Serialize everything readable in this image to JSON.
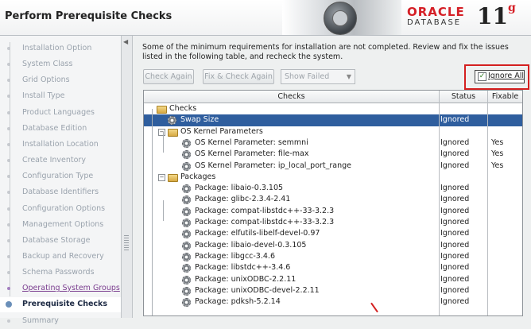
{
  "window": {
    "title": "Perform Prerequisite Checks"
  },
  "brand": {
    "oracle": "ORACLE",
    "database": "DATABASE",
    "version": "11",
    "version_sup": "g"
  },
  "sidebar": {
    "items": [
      {
        "label": "Installation Option",
        "state": "done"
      },
      {
        "label": "System Class",
        "state": "done"
      },
      {
        "label": "Grid Options",
        "state": "done"
      },
      {
        "label": "Install Type",
        "state": "done"
      },
      {
        "label": "Product Languages",
        "state": "done"
      },
      {
        "label": "Database Edition",
        "state": "done"
      },
      {
        "label": "Installation Location",
        "state": "done"
      },
      {
        "label": "Create Inventory",
        "state": "done"
      },
      {
        "label": "Configuration Type",
        "state": "done"
      },
      {
        "label": "Database Identifiers",
        "state": "done"
      },
      {
        "label": "Configuration Options",
        "state": "done"
      },
      {
        "label": "Management Options",
        "state": "done"
      },
      {
        "label": "Database Storage",
        "state": "done"
      },
      {
        "label": "Backup and Recovery",
        "state": "done"
      },
      {
        "label": "Schema Passwords",
        "state": "done"
      },
      {
        "label": "Operating System Groups",
        "state": "link"
      },
      {
        "label": "Prerequisite Checks",
        "state": "current"
      },
      {
        "label": "Summary",
        "state": "next"
      }
    ]
  },
  "main": {
    "message": "Some of the minimum requirements for installation are not completed. Review and fix the issues listed in the following table, and recheck the system.",
    "toolbar": {
      "check_again": "Check Again",
      "fix_check_again": "Fix & Check Again",
      "filter_value": "Show Failed",
      "ignore_all": "Ignore All",
      "ignore_all_checked": true
    },
    "table": {
      "headers": {
        "checks": "Checks",
        "status": "Status",
        "fixable": "Fixable"
      },
      "rows": [
        {
          "name": "Checks",
          "status": "",
          "fixable": "",
          "level": 0,
          "icon": "folder-icon",
          "toggle": ""
        },
        {
          "name": "Swap Size",
          "status": "Ignored",
          "fixable": "",
          "level": 1,
          "icon": "gear-icon",
          "toggle": "",
          "selected": true
        },
        {
          "name": "OS Kernel Parameters",
          "status": "",
          "fixable": "",
          "level": 1,
          "icon": "folder-icon",
          "toggle": "−"
        },
        {
          "name": "OS Kernel Parameter: semmni",
          "status": "Ignored",
          "fixable": "Yes",
          "level": 2,
          "icon": "gear-icon",
          "toggle": ""
        },
        {
          "name": "OS Kernel Parameter: file-max",
          "status": "Ignored",
          "fixable": "Yes",
          "level": 2,
          "icon": "gear-icon",
          "toggle": ""
        },
        {
          "name": "OS Kernel Parameter: ip_local_port_range",
          "status": "Ignored",
          "fixable": "Yes",
          "level": 2,
          "icon": "gear-icon",
          "toggle": ""
        },
        {
          "name": "Packages",
          "status": "",
          "fixable": "",
          "level": 1,
          "icon": "folder-icon",
          "toggle": "−"
        },
        {
          "name": "Package: libaio-0.3.105",
          "status": "Ignored",
          "fixable": "",
          "level": 2,
          "icon": "gear-icon",
          "toggle": ""
        },
        {
          "name": "Package: glibc-2.3.4-2.41",
          "status": "Ignored",
          "fixable": "",
          "level": 2,
          "icon": "gear-icon",
          "toggle": ""
        },
        {
          "name": "Package: compat-libstdc++-33-3.2.3",
          "status": "Ignored",
          "fixable": "",
          "level": 2,
          "icon": "gear-icon",
          "toggle": ""
        },
        {
          "name": "Package: compat-libstdc++-33-3.2.3",
          "status": "Ignored",
          "fixable": "",
          "level": 2,
          "icon": "gear-icon",
          "toggle": ""
        },
        {
          "name": "Package: elfutils-libelf-devel-0.97",
          "status": "Ignored",
          "fixable": "",
          "level": 2,
          "icon": "gear-icon",
          "toggle": ""
        },
        {
          "name": "Package: libaio-devel-0.3.105",
          "status": "Ignored",
          "fixable": "",
          "level": 2,
          "icon": "gear-icon",
          "toggle": ""
        },
        {
          "name": "Package: libgcc-3.4.6",
          "status": "Ignored",
          "fixable": "",
          "level": 2,
          "icon": "gear-icon",
          "toggle": ""
        },
        {
          "name": "Package: libstdc++-3.4.6",
          "status": "Ignored",
          "fixable": "",
          "level": 2,
          "icon": "gear-icon",
          "toggle": ""
        },
        {
          "name": "Package: unixODBC-2.2.11",
          "status": "Ignored",
          "fixable": "",
          "level": 2,
          "icon": "gear-icon",
          "toggle": ""
        },
        {
          "name": "Package: unixODBC-devel-2.2.11",
          "status": "Ignored",
          "fixable": "",
          "level": 2,
          "icon": "gear-icon",
          "toggle": ""
        },
        {
          "name": "Package: pdksh-5.2.14",
          "status": "Ignored",
          "fixable": "",
          "level": 2,
          "icon": "gear-icon",
          "toggle": ""
        }
      ]
    }
  },
  "colors": {
    "selection": "#2f5e9e",
    "highlight_box": "#d42020",
    "brand_red": "#d51f26"
  }
}
